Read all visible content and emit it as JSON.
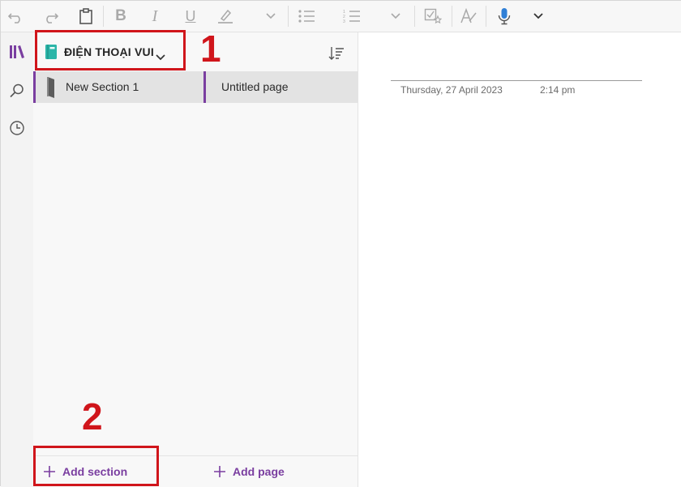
{
  "toolbar": {
    "icons": [
      "undo-icon",
      "redo-icon",
      "clipboard-icon",
      "bold-icon",
      "italic-icon",
      "underline-icon",
      "highlighter-icon",
      "chevron-down-icon",
      "bullet-list-icon",
      "numbered-list-icon",
      "chevron-down-icon",
      "todo-tag-icon",
      "styles-icon",
      "microphone-icon",
      "chevron-down-icon"
    ],
    "bold": "B",
    "italic": "I",
    "underline": "U"
  },
  "rail": {
    "icons": [
      "notebooks-icon",
      "search-icon",
      "recent-icon"
    ]
  },
  "notebook": {
    "name": "ĐIỆN THOẠI VUI",
    "accent_color": "#2bb5a8"
  },
  "sections": {
    "items": [
      {
        "label": "New Section 1"
      }
    ],
    "add_label": "Add section"
  },
  "pages": {
    "items": [
      {
        "label": "Untitled page"
      }
    ],
    "add_label": "Add page"
  },
  "page": {
    "date": "Thursday, 27 April 2023",
    "time": "2:14 pm"
  },
  "annotations": {
    "marker_1": "1",
    "marker_2": "2",
    "color": "#d0151b"
  },
  "colors": {
    "accent": "#7a3ea0"
  }
}
